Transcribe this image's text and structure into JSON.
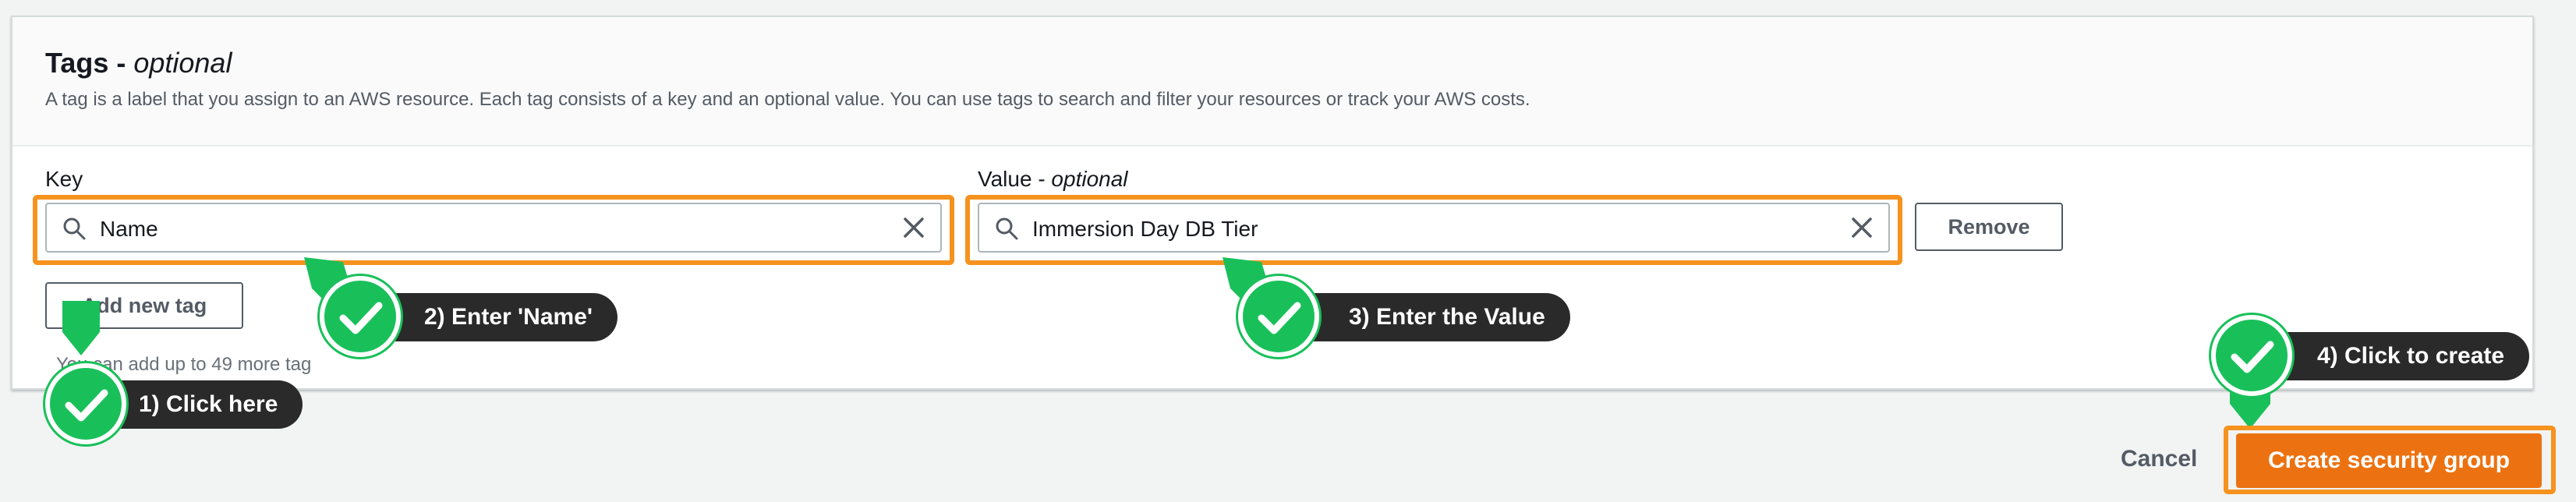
{
  "tags": {
    "title": "Tags - ",
    "title_optional": "optional",
    "description": "A tag is a label that you assign to an AWS resource. Each tag consists of a key and an optional value. You can use tags to search and filter your resources or track your AWS costs."
  },
  "key_field": {
    "label": "Key",
    "value": "Name"
  },
  "value_field": {
    "label": "Value - ",
    "label_optional": "optional",
    "value": "Immersion Day DB Tier"
  },
  "buttons": {
    "remove": "Remove",
    "add_new_tag": "Add new tag",
    "cancel": "Cancel",
    "create": "Create security group"
  },
  "hint": "You can add up to 49 more tag",
  "callouts": {
    "step1": "1) Click here",
    "step2": "2) Enter 'Name'",
    "step3": "3) Enter the Value",
    "step4": "4) Click to create"
  },
  "colors": {
    "highlight": "#f6921e",
    "primary_button": "#ec7211",
    "check_green": "#19c05a",
    "callout_bg": "#2a2a2a"
  },
  "icons": [
    "search-icon",
    "clear-icon",
    "check-icon"
  ]
}
